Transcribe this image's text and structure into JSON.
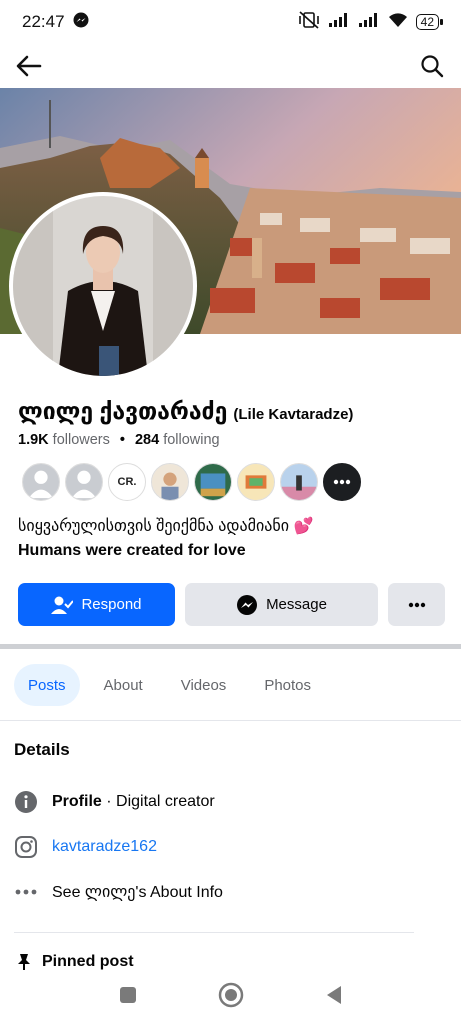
{
  "status_bar": {
    "time": "22:47",
    "battery": "42"
  },
  "nav": {
    "back_icon": "arrow-left-icon",
    "search_icon": "search-icon"
  },
  "profile": {
    "name_main": "ლილე ქავთარაძე",
    "name_sub": "(Lile Kavtaradze)",
    "followers_count": "1.9K",
    "followers_label": "followers",
    "following_count": "284",
    "following_label": "following",
    "bio_line1": "სიყვარულისთვის შეიქმნა ადამიანი 💕",
    "bio_line2": "Humans were created for love"
  },
  "friends": {
    "thumb3_label": "CR."
  },
  "actions": {
    "respond_label": "Respond",
    "message_label": "Message"
  },
  "tabs": [
    {
      "label": "Posts",
      "active": true
    },
    {
      "label": "About",
      "active": false
    },
    {
      "label": "Videos",
      "active": false
    },
    {
      "label": "Photos",
      "active": false
    }
  ],
  "details": {
    "title": "Details",
    "profile_key": "Profile",
    "profile_value": " · Digital creator",
    "instagram": "kavtaradze162",
    "about_info": "See ლილე's About Info"
  },
  "pinned": {
    "label": "Pinned post"
  },
  "colors": {
    "accent": "#0866ff",
    "link": "#1877f2",
    "button_gray": "#e4e6eb"
  }
}
